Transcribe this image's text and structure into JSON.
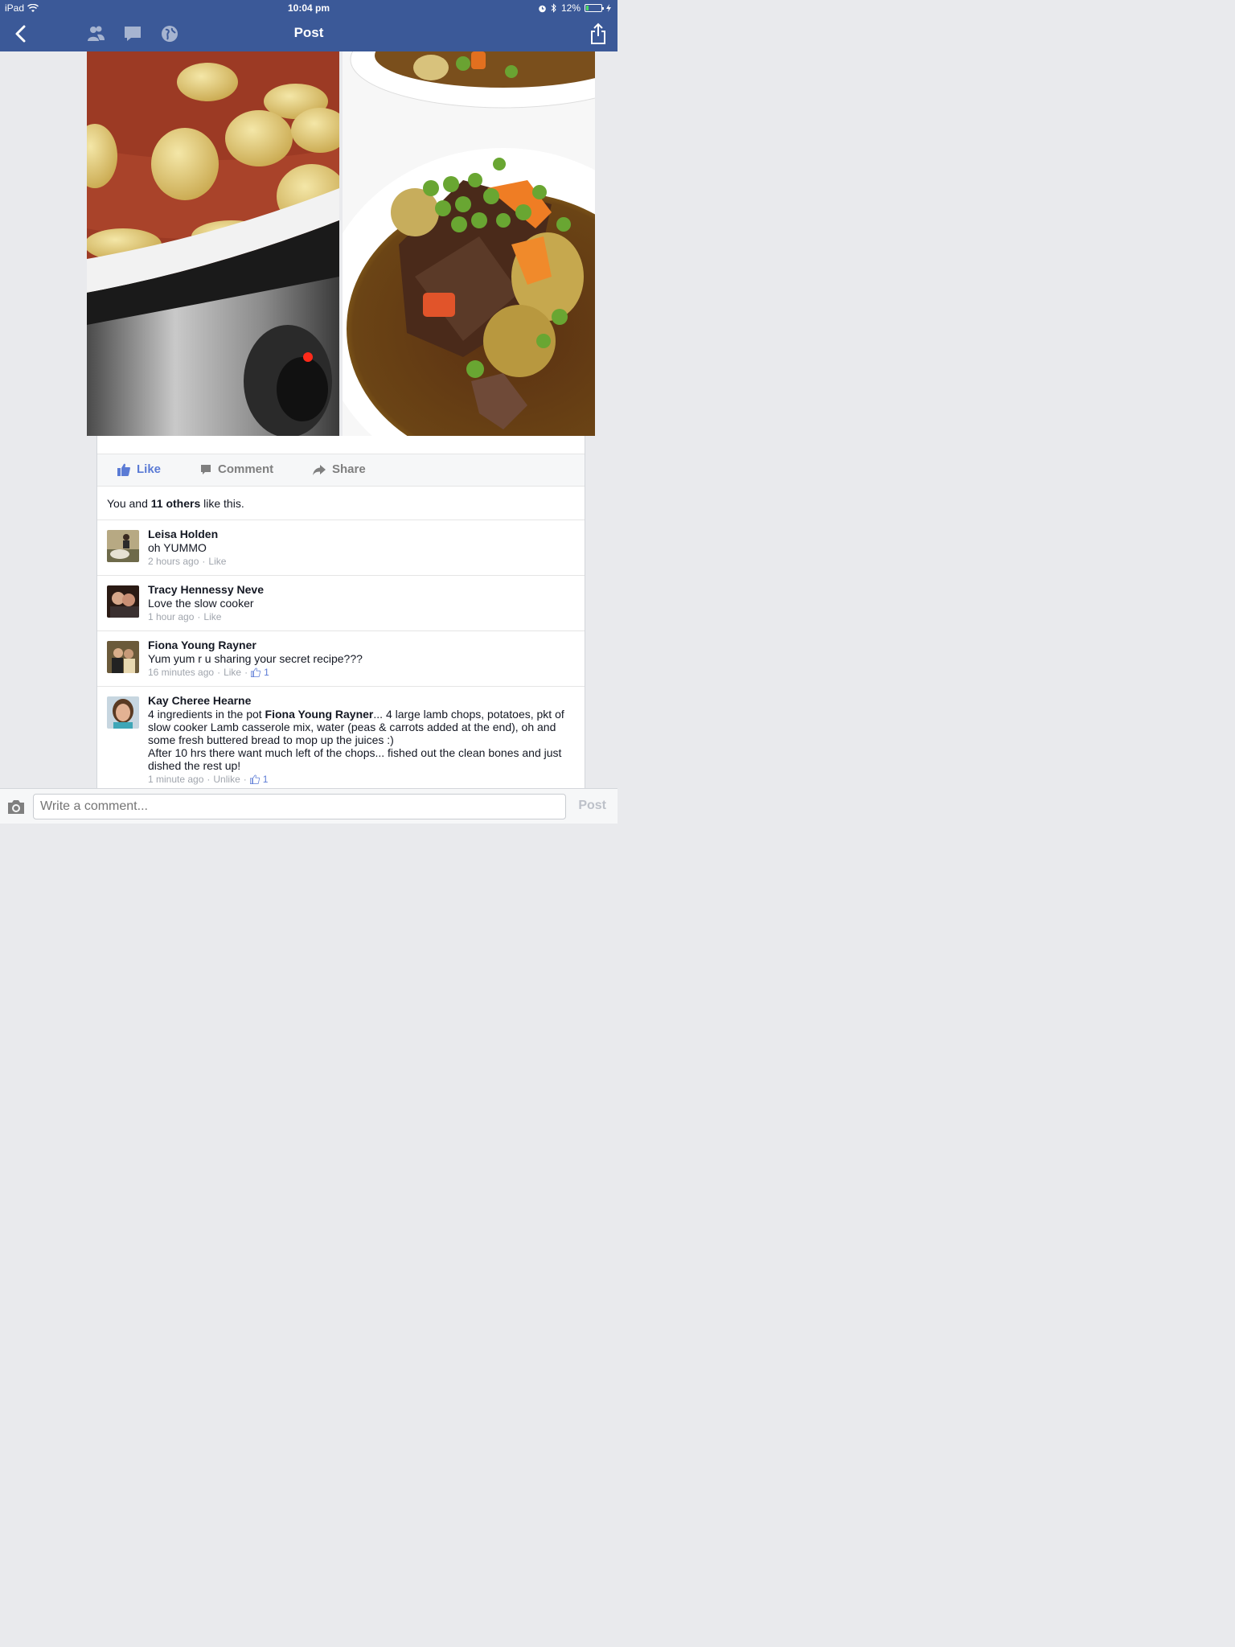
{
  "status": {
    "device": "iPad",
    "time": "10:04 pm",
    "battery": "12%"
  },
  "nav": {
    "title": "Post"
  },
  "actions": {
    "like": "Like",
    "comment": "Comment",
    "share": "Share"
  },
  "likes": {
    "prefix": "You and",
    "count": "11 others",
    "suffix": "like this."
  },
  "comments": [
    {
      "name": "Leisa Holden",
      "text": "oh YUMMO",
      "time": "2 hours ago",
      "action": "Like",
      "likes": ""
    },
    {
      "name": "Tracy Hennessy Neve",
      "text": "Love the slow cooker",
      "time": "1 hour ago",
      "action": "Like",
      "likes": ""
    },
    {
      "name": "Fiona Young Rayner",
      "text": "Yum yum r u sharing your secret recipe???",
      "time": "16 minutes ago",
      "action": "Like",
      "likes": "1"
    },
    {
      "name": "Kay Cheree Hearne",
      "text_pre": "4 ingredients in the pot ",
      "mention": "Fiona Young Rayner",
      "text_post": "... 4 large lamb chops, potatoes, pkt of slow cooker Lamb casserole mix, water (peas & carrots added at the end), oh and some fresh buttered bread to mop up the juices :)",
      "text2": "After 10 hrs there want much left of the chops... fished out the clean bones and just dished the rest up!",
      "time": "1 minute ago",
      "action": "Unlike",
      "likes": "1"
    }
  ],
  "composer": {
    "placeholder": "Write a comment...",
    "post": "Post"
  }
}
